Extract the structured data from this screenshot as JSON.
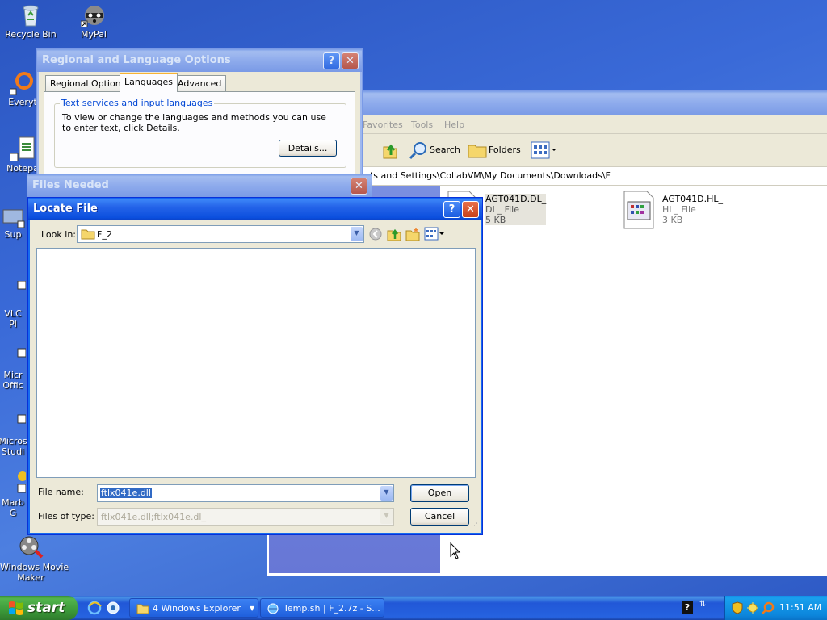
{
  "desktop": {
    "icons": [
      {
        "label": "Recycle Bin"
      },
      {
        "label": "MyPal"
      },
      {
        "label": "Everyt"
      },
      {
        "label": "Notepa"
      },
      {
        "label": "Sup"
      },
      {
        "label": "VLC\nPl"
      },
      {
        "label": "Micr\nOffic"
      },
      {
        "label": "Micros\nStudi"
      },
      {
        "label": "Marb\nG"
      },
      {
        "label": "Windows Movie\nMaker"
      }
    ]
  },
  "explorer": {
    "menu": [
      "Favorites",
      "Tools",
      "Help"
    ],
    "toolbar": {
      "search": "Search",
      "folders": "Folders"
    },
    "address": "nts and Settings\\CollabVM\\My Documents\\Downloads\\F",
    "files": [
      {
        "name": "AGT041D.DL_",
        "type": "DL_ File",
        "size": "5 KB"
      },
      {
        "name": "AGT041D.HL_",
        "type": "HL_ File",
        "size": "3 KB"
      }
    ]
  },
  "regional": {
    "title": "Regional and Language Options",
    "tabs": [
      "Regional Options",
      "Languages",
      "Advanced"
    ],
    "group_title": "Text services and input languages",
    "group_text": "To view or change the languages and methods you can use to enter text, click Details.",
    "details_button": "Details..."
  },
  "files_needed": {
    "title": "Files Needed"
  },
  "locate": {
    "title": "Locate File",
    "look_in_label": "Look in:",
    "look_in_value": "F_2",
    "file_name_label": "File name:",
    "file_name_value": "ftlx041e.dll",
    "file_type_label": "Files of type:",
    "file_type_value": "ftlx041e.dll;ftlx041e.dl_",
    "open_button": "Open",
    "cancel_button": "Cancel"
  },
  "taskbar": {
    "start": "start",
    "buttons": [
      {
        "label": "4 Windows Explorer"
      },
      {
        "label": "Temp.sh | F_2.7z - S..."
      }
    ],
    "clock": "11:51 AM"
  },
  "colors": {
    "xp_blue": "#0a5cf2",
    "start_green": "#3c9a3a",
    "tray_blue": "#0c86dc"
  }
}
